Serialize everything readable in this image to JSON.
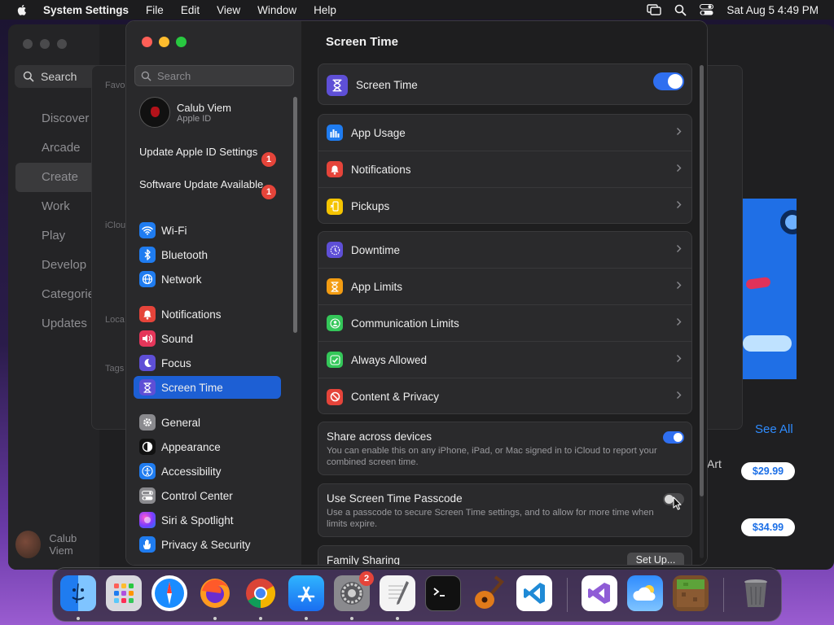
{
  "menubar": {
    "apple_icon": "apple-logo-icon",
    "app_name": "System Settings",
    "menus": [
      "File",
      "Edit",
      "View",
      "Window",
      "Help"
    ],
    "datetime": "Sat Aug 5  4:49 PM"
  },
  "appstore_bg": {
    "search_label": "Search",
    "nav": [
      "Discover",
      "Arcade",
      "Create",
      "Work",
      "Play",
      "Develop",
      "Categories",
      "Updates"
    ],
    "active_nav": "Create",
    "user_name": "Calub Viem",
    "section_labels": [
      "Favo",
      "iClou",
      "Loca",
      "Tags"
    ],
    "see_all": "See All",
    "art_label": "Art",
    "prices": [
      "$29.99",
      "$34.99"
    ]
  },
  "settings": {
    "search_placeholder": "Search",
    "profile": {
      "name": "Calub Viem",
      "subtitle": "Apple ID"
    },
    "alerts": [
      {
        "label": "Update Apple ID Settings",
        "count": "1"
      },
      {
        "label": "Software Update Available",
        "count": "1"
      }
    ],
    "sidebar_groups": [
      [
        "Wi-Fi",
        "Bluetooth",
        "Network"
      ],
      [
        "Notifications",
        "Sound",
        "Focus",
        "Screen Time"
      ],
      [
        "General",
        "Appearance",
        "Accessibility",
        "Control Center",
        "Siri & Spotlight",
        "Privacy & Security"
      ]
    ],
    "active_item": "Screen Time",
    "content": {
      "title": "Screen Time",
      "header_row": {
        "label": "Screen Time",
        "enabled": true
      },
      "usage_rows": [
        "App Usage",
        "Notifications",
        "Pickups"
      ],
      "limit_rows": [
        "Downtime",
        "App Limits",
        "Communication Limits",
        "Always Allowed",
        "Content & Privacy"
      ],
      "share": {
        "title": "Share across devices",
        "description": "You can enable this on any iPhone, iPad, or Mac signed in to iCloud to report your combined screen time.",
        "enabled": true
      },
      "passcode": {
        "title": "Use Screen Time Passcode",
        "description": "Use a passcode to secure Screen Time settings, and to allow for more time when limits expire.",
        "enabled": false
      },
      "family": {
        "title": "Family Sharing",
        "button": "Set Up..."
      }
    }
  },
  "dock": {
    "apps": [
      "Finder",
      "Launchpad",
      "Safari",
      "Firefox",
      "Chrome",
      "App Store",
      "System Settings",
      "TextEdit",
      "Terminal",
      "GarageBand",
      "Visual Studio Code",
      "Visual Studio",
      "Weather",
      "Minecraft",
      "Trash"
    ],
    "settings_badge": "2"
  },
  "colors": {
    "accent": "#1d5fd4",
    "toggle_on": "#2f6ff0",
    "badge": "#e5443a"
  }
}
